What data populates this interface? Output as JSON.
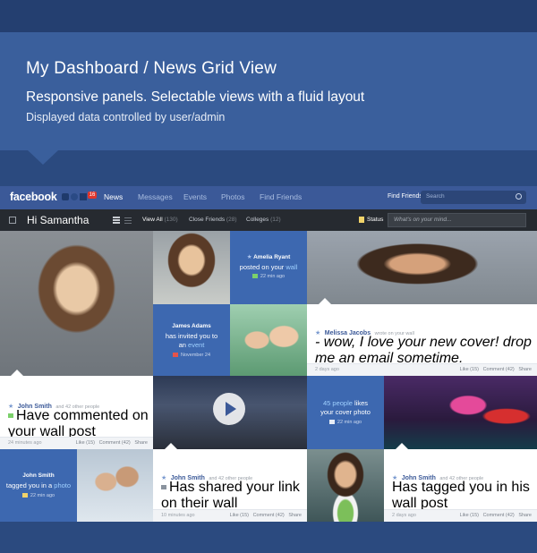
{
  "hero": {
    "title": "My Dashboard / News Grid View",
    "subtitle": "Responsive panels. Selectable views with a fluid layout",
    "caption": "Displayed data controlled by user/admin"
  },
  "topnav": {
    "logo": "facebook",
    "notification_count": "16",
    "items": [
      "News",
      "Messages",
      "Events",
      "Photos",
      "Find Friends"
    ],
    "find_friends_label": "Find Friends",
    "search_placeholder": "Search"
  },
  "subbar": {
    "greeting": "Hi Samantha",
    "tabs": [
      {
        "label": "View All",
        "count": "(130)"
      },
      {
        "label": "Close Friends",
        "count": "(28)"
      },
      {
        "label": "Colleges",
        "count": "(12)"
      }
    ],
    "status_label": "Status",
    "mind_placeholder": "What's on your mind..."
  },
  "cards": {
    "amelia": {
      "name": "Amelia Ryant",
      "action": "posted on your",
      "link": "wall",
      "time": "22 min ago"
    },
    "james": {
      "name": "James Adams",
      "line1": "has invited you to",
      "line2": "an",
      "link": "event",
      "date": "November 24"
    },
    "melissa": {
      "name": "Melissa Jacobs",
      "suffix": "wrote on your wall",
      "text": "wow, I love your new cover! drop me an email sometime.",
      "ago": "2 days ago",
      "like": "Like (15)",
      "comment": "Comment (42)",
      "share": "Share"
    },
    "john1": {
      "name": "John Smith",
      "others": "and 42 other people",
      "text": "Have commented on your wall post",
      "ago": "24 minutes ago",
      "like": "Like (15)",
      "comment": "Comment (42)",
      "share": "Share"
    },
    "people": {
      "count": "45 people",
      "line1": "likes",
      "line2": "your cover photo",
      "time": "22 min ago"
    },
    "john_tag": {
      "name": "John Smith",
      "line1": "tagged you in a",
      "link": "photo",
      "time": "22 min ago"
    },
    "john2": {
      "name": "John Smith",
      "others": "and 42 other people",
      "text": "Has shared your link on their wall",
      "ago": "10 minutes ago",
      "like": "Like (15)",
      "comment": "Comment (42)",
      "share": "Share"
    },
    "john3": {
      "name": "John Smith",
      "others": "and 42 other people",
      "text": "Has tagged you in his wall post",
      "ago": "2 days ago",
      "like": "Like (15)",
      "comment": "Comment (42)",
      "share": "Share"
    }
  },
  "colors": {
    "brand": "#3b5998",
    "card_blue": "#3d68b0",
    "hero": "#3a5f9c"
  }
}
